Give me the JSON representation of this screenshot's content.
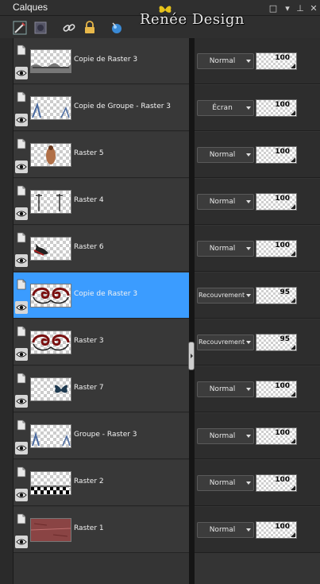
{
  "panel": {
    "title": "Calques"
  },
  "window_controls": {
    "restore": "□",
    "menu": "▾",
    "pin": "⊥",
    "close": "✕"
  },
  "watermark": {
    "text": "Renée Design"
  },
  "toolbar": {
    "tools": [
      "brush-tool-icon",
      "mask-icon",
      "link-icon",
      "lock-icon",
      "globe-icon"
    ]
  },
  "layers": [
    {
      "name": "Copie de Raster 3",
      "blend": "Normal",
      "opacity": "100",
      "selected": false,
      "thumb": "rocks"
    },
    {
      "name": "Copie de Groupe - Raster 3",
      "blend": "Écran",
      "opacity": "100",
      "selected": false,
      "thumb": "corner-left"
    },
    {
      "name": "Raster 5",
      "blend": "Normal",
      "opacity": "100",
      "selected": false,
      "thumb": "figure"
    },
    {
      "name": "Raster 4",
      "blend": "Normal",
      "opacity": "100",
      "selected": false,
      "thumb": "poles"
    },
    {
      "name": "Raster 6",
      "blend": "Normal",
      "opacity": "100",
      "selected": false,
      "thumb": "dark-object"
    },
    {
      "name": "Copie de Raster 3",
      "blend": "Recouvrement",
      "opacity": "95",
      "selected": true,
      "thumb": "swirls"
    },
    {
      "name": "Raster 3",
      "blend": "Recouvrement",
      "opacity": "95",
      "selected": false,
      "thumb": "swirls"
    },
    {
      "name": "Raster 7",
      "blend": "Normal",
      "opacity": "100",
      "selected": false,
      "thumb": "butterfly"
    },
    {
      "name": "Groupe - Raster 3",
      "blend": "Normal",
      "opacity": "100",
      "selected": false,
      "thumb": "corner-both"
    },
    {
      "name": "Raster 2",
      "blend": "Normal",
      "opacity": "100",
      "selected": false,
      "thumb": "checker-floor"
    },
    {
      "name": "Raster 1",
      "blend": "Normal",
      "opacity": "100",
      "selected": false,
      "thumb": "red-texture"
    }
  ]
}
